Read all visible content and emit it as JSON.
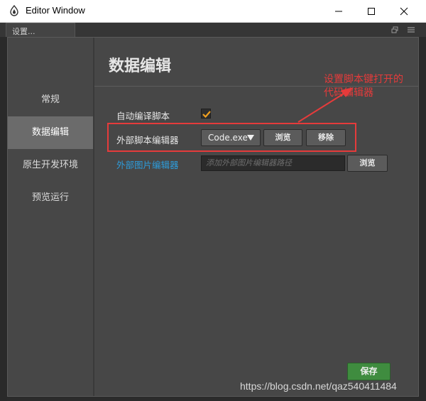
{
  "window": {
    "title": "Editor Window"
  },
  "dock": {
    "tab_label": "设置..."
  },
  "nav": {
    "items": [
      {
        "label": "常规"
      },
      {
        "label": "数据编辑"
      },
      {
        "label": "原生开发环境"
      },
      {
        "label": "预览运行"
      }
    ],
    "active_index": 1
  },
  "page": {
    "title": "数据编辑",
    "auto_compile_label": "自动编译脚本",
    "auto_compile_checked": true,
    "script_editor_label": "外部脚本编辑器",
    "script_editor_value": "Code.exe",
    "browse_label": "浏览",
    "remove_label": "移除",
    "image_editor_label": "外部图片编辑器",
    "image_editor_placeholder": "添加外部图片编辑器路径",
    "image_browse_label": "浏览",
    "save_label": "保存"
  },
  "annotation": {
    "line1": "设置脚本键打开的",
    "line2": "代码编辑器",
    "color": "#e53b3b"
  },
  "watermark": "https://blog.csdn.net/qaz540411484",
  "colors": {
    "link": "#2d9cdb",
    "save_button": "#3f8c3f",
    "checkmark": "#f0a020"
  }
}
